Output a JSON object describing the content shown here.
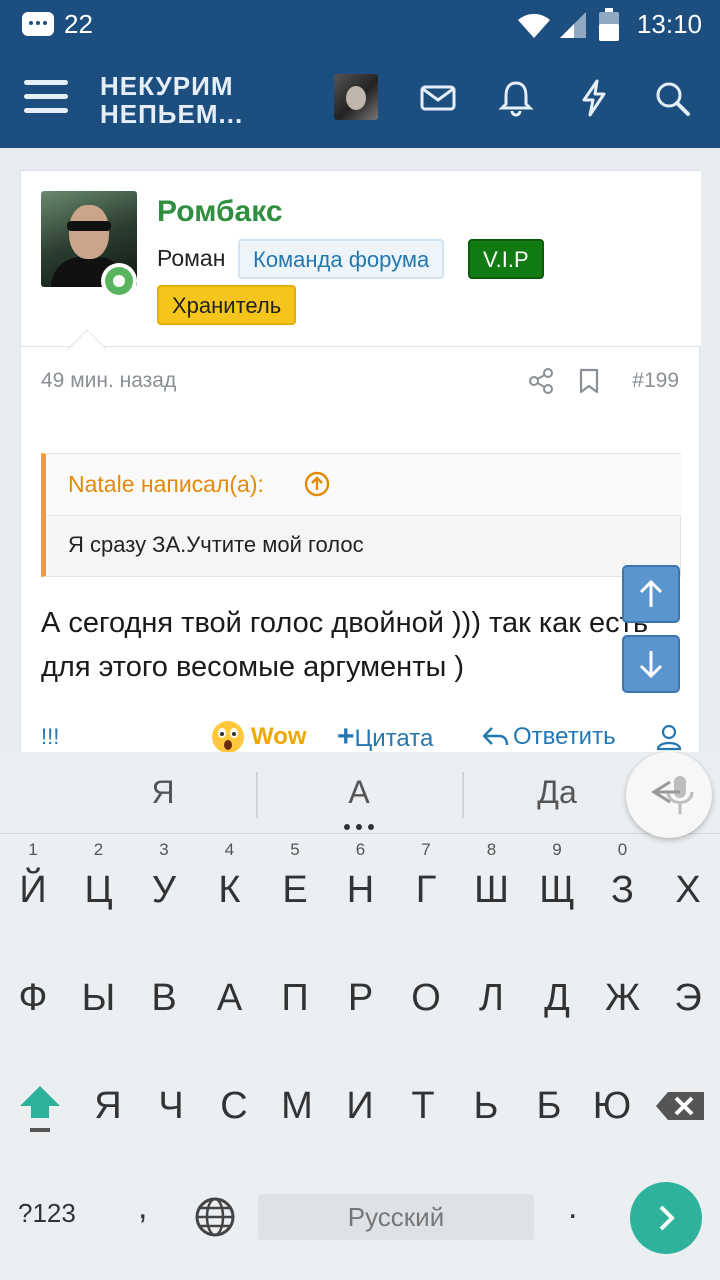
{
  "status_bar": {
    "notification_count": "22",
    "time": "13:10"
  },
  "header": {
    "logo_line1": "НЕКУРИМ",
    "logo_line2": "НЕПЬЕМ..."
  },
  "post": {
    "username": "Ромбакс",
    "real_name": "Роман",
    "badges": {
      "team": "Команда форума",
      "vip": "V.I.P",
      "keeper": "Хранитель"
    },
    "time_ago": "49 мин. назад",
    "post_number": "#199",
    "quote": {
      "author": "Natale написал(а):",
      "text": "Я сразу ЗА.Учтите мой голос"
    },
    "message": "А сегодня твой голос двойной ))) так как есть для этого весомые аргументы )",
    "actions": {
      "report": "!!!",
      "reaction": "Wow",
      "quote": "Цитата",
      "reply": "Ответить"
    }
  },
  "keyboard": {
    "suggestions": [
      "Я",
      "А",
      "Да"
    ],
    "row1": [
      "Й",
      "Ц",
      "У",
      "К",
      "Е",
      "Н",
      "Г",
      "Ш",
      "Щ",
      "З",
      "Х"
    ],
    "row1_hints": [
      "1",
      "2",
      "3",
      "4",
      "5",
      "6",
      "7",
      "8",
      "9",
      "0"
    ],
    "row2": [
      "Ф",
      "Ы",
      "В",
      "А",
      "П",
      "Р",
      "О",
      "Л",
      "Д",
      "Ж",
      "Э"
    ],
    "row3": [
      "Я",
      "Ч",
      "С",
      "М",
      "И",
      "Т",
      "Ь",
      "Б",
      "Ю"
    ],
    "symbols_label": "?123",
    "comma": ",",
    "period": ".",
    "space_label": "Русский"
  },
  "colors": {
    "header_bg": "#1c4f80",
    "username": "#2f8f3f",
    "link": "#2577b1",
    "quote_accent": "#f1a02b",
    "vip": "#127a12",
    "keeper": "#f6c51b",
    "go_key": "#2fb29b"
  }
}
